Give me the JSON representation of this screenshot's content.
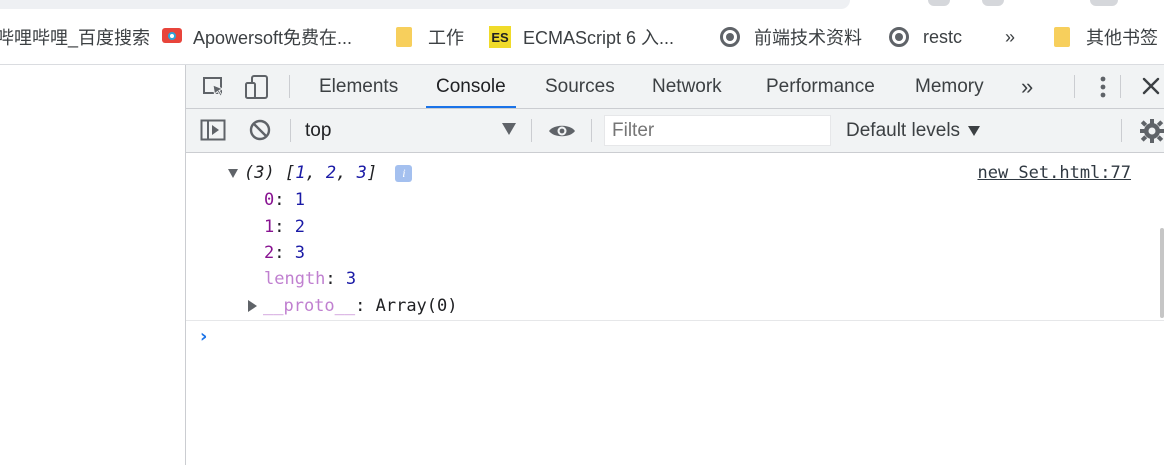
{
  "bookmarks": {
    "items": [
      {
        "label": "哔哩哔哩_百度搜索",
        "icon": "none"
      },
      {
        "label": "Apowersoft免费在...",
        "icon": "recorder-icon"
      },
      {
        "label": "工作",
        "icon": "folder-icon"
      },
      {
        "label": "ECMAScript 6 入...",
        "icon": "es-icon"
      },
      {
        "label": "前端技术资料",
        "icon": "globe-icon"
      },
      {
        "label": "restc",
        "icon": "globe-icon"
      },
      {
        "label": "»",
        "icon": "none"
      },
      {
        "label": "其他书签",
        "icon": "folder-icon"
      }
    ]
  },
  "devtools": {
    "tabs": [
      "Elements",
      "Console",
      "Sources",
      "Network",
      "Performance",
      "Memory"
    ],
    "active_tab": "Console",
    "more_tabs": "»",
    "close": "✕",
    "toolbar": {
      "context": "top",
      "filter_placeholder": "Filter",
      "levels": "Default levels"
    }
  },
  "console": {
    "source_link": "new Set.html:77",
    "summary": "(3) [1, 2, 3]",
    "summary_prefix": "(3) [",
    "summary_values": [
      "1",
      "2",
      "3"
    ],
    "entries": [
      {
        "key": "0",
        "value": "1"
      },
      {
        "key": "1",
        "value": "2"
      },
      {
        "key": "2",
        "value": "3"
      }
    ],
    "length_key": "length",
    "length_value": "3",
    "proto_key": "__proto__",
    "proto_value": "Array(0)",
    "info_badge": "i",
    "prompt": "›"
  },
  "colors": {
    "accent": "#1a73e8",
    "key": "#881391",
    "number": "#1a1aa6",
    "toolbar_bg": "#f1f3f4"
  }
}
